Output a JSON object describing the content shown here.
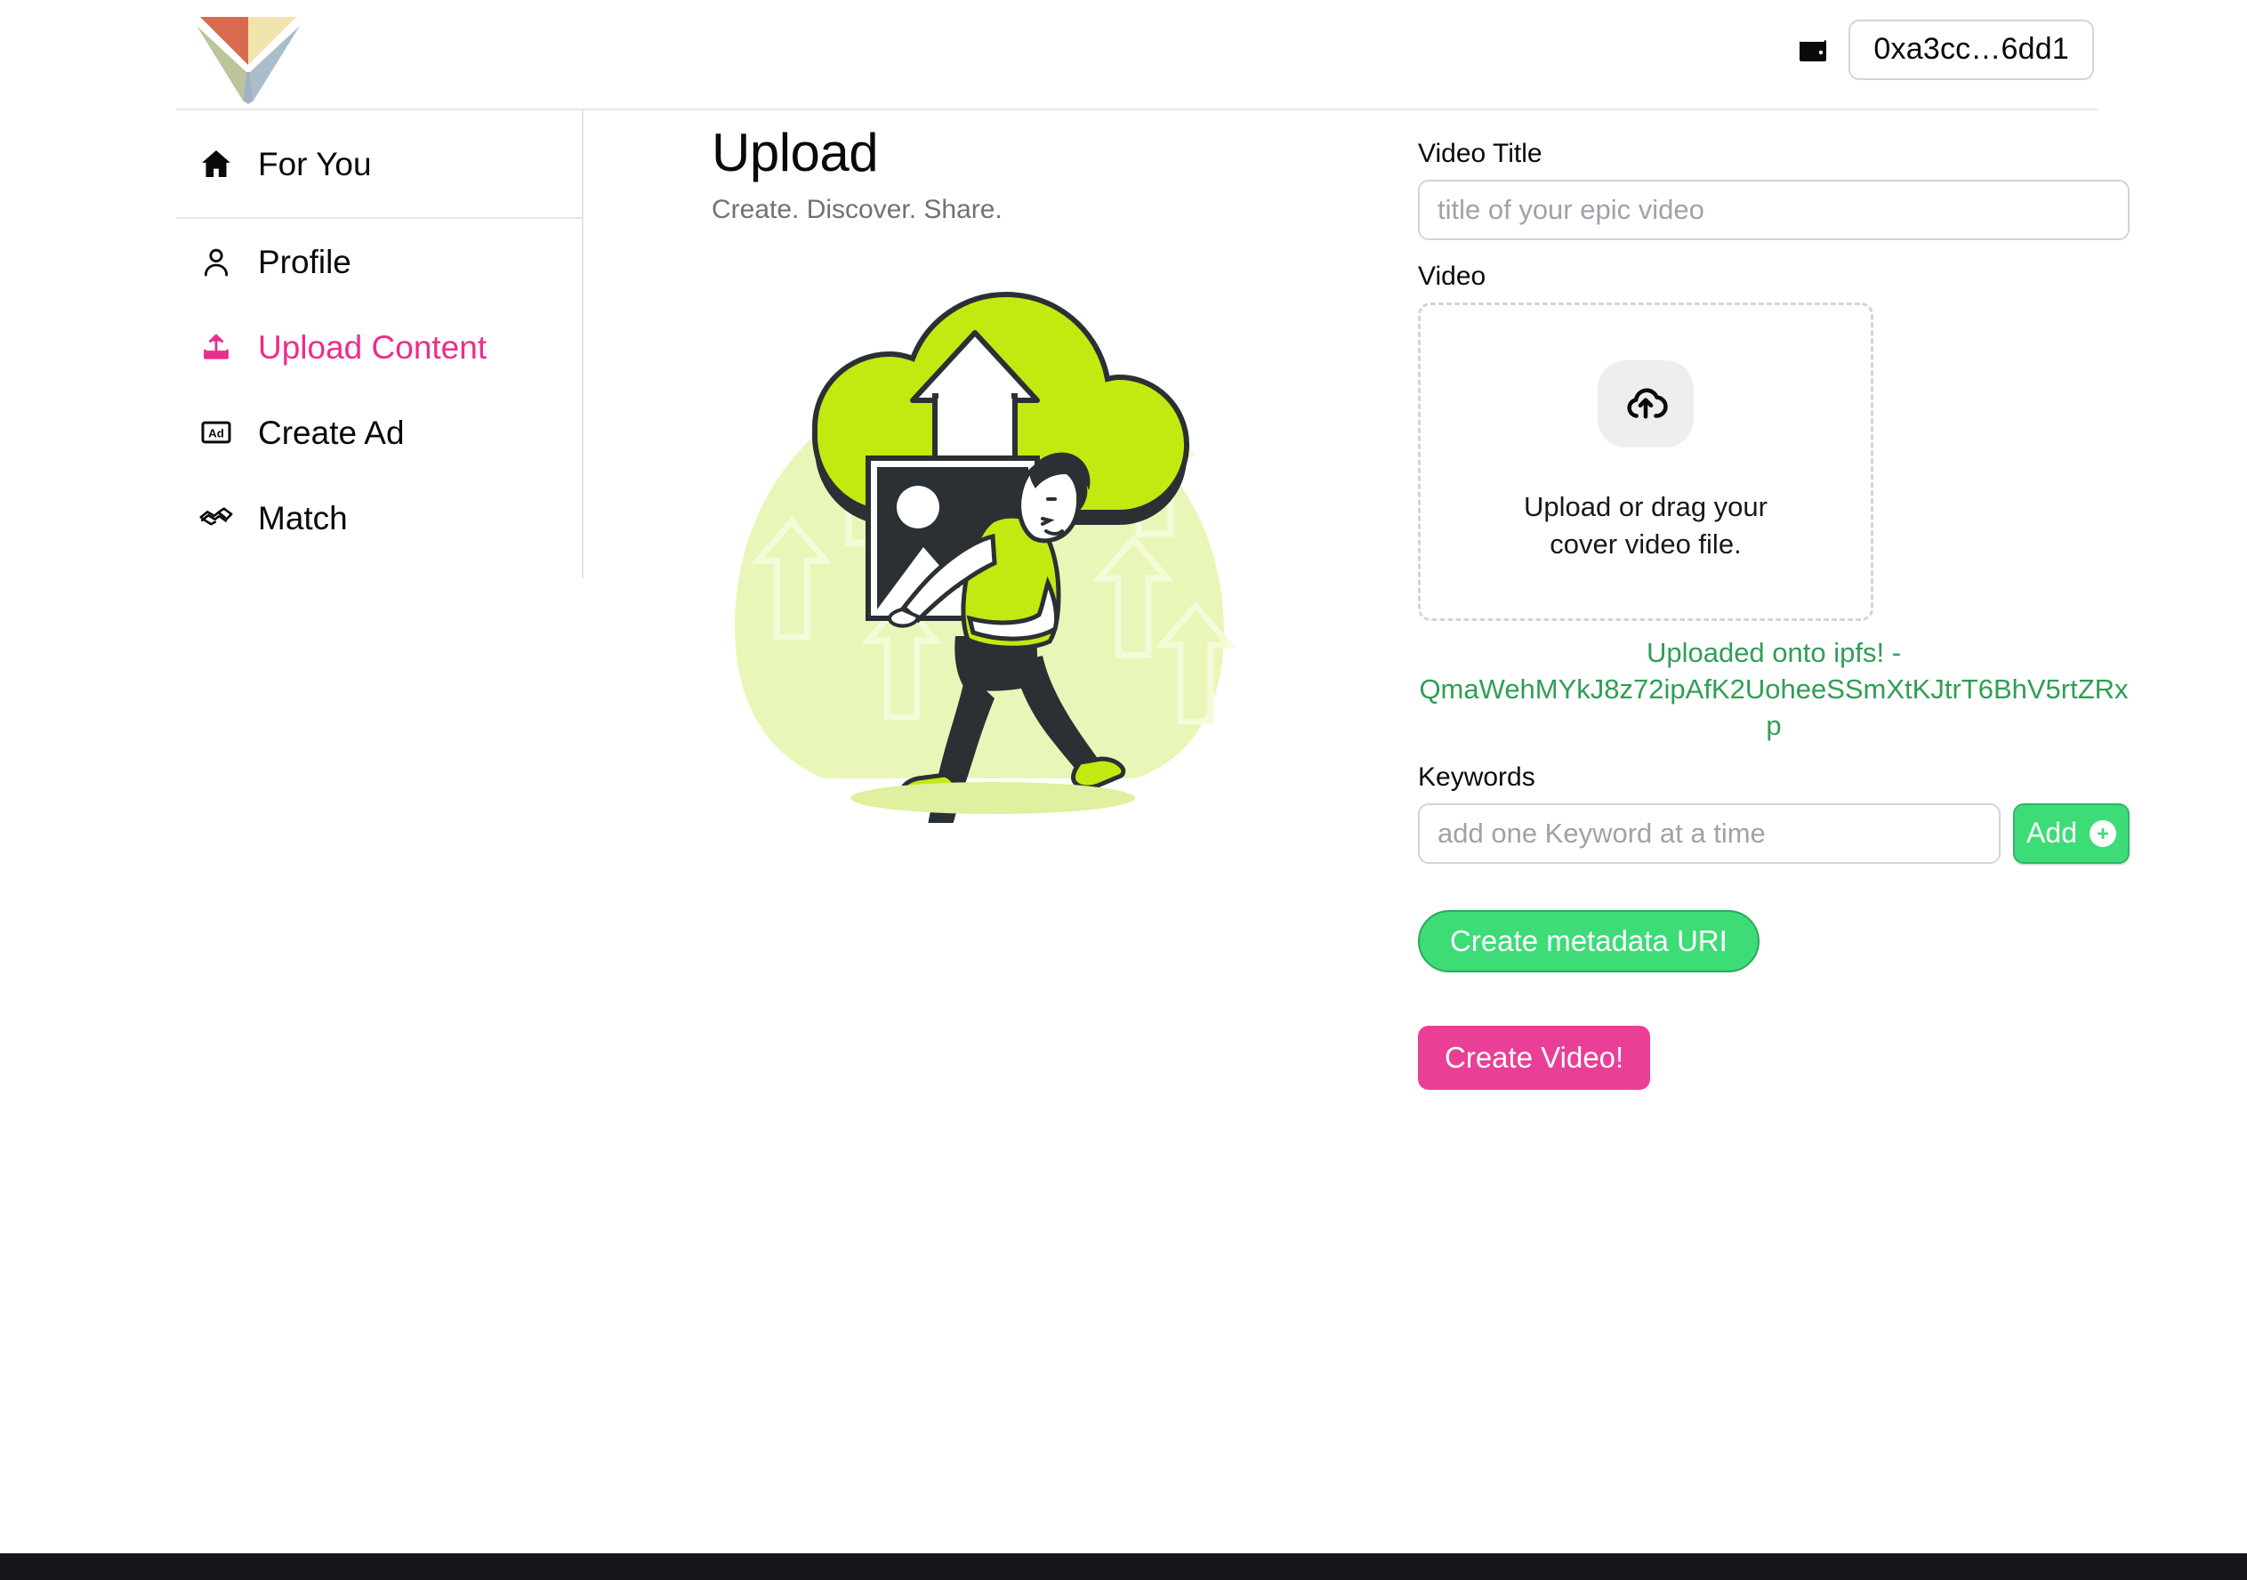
{
  "header": {
    "logo_name": "vfinity-logo",
    "wallet_icon": "wallet-icon",
    "wallet_address": "0xa3cc…6dd1"
  },
  "sidebar": {
    "items": [
      {
        "label": "For You",
        "icon": "home-icon",
        "active": false
      },
      {
        "label": "Profile",
        "icon": "user-icon",
        "active": false
      },
      {
        "label": "Upload Content",
        "icon": "upload-icon",
        "active": true
      },
      {
        "label": "Create Ad",
        "icon": "ad-box-icon",
        "active": false
      },
      {
        "label": "Match",
        "icon": "handshake-icon",
        "active": false
      }
    ]
  },
  "main": {
    "title": "Upload",
    "subtitle": "Create. Discover. Share.",
    "illustration_name": "person-carrying-image-to-cloud-illustration"
  },
  "form": {
    "video_title_label": "Video Title",
    "video_title_placeholder": "title of your epic video",
    "video_title_value": "",
    "video_label": "Video",
    "dropzone_icon": "cloud-upload-icon",
    "dropzone_line1": "Upload or drag your",
    "dropzone_line2": "cover video file.",
    "ipfs_status_line1": "Uploaded onto ipfs! -",
    "ipfs_hash": "QmaWehMYkJ8z72ipAfK2UoheeSSmXtKJtrT6BhV5rtZRxp",
    "keywords_label": "Keywords",
    "keywords_placeholder": "add one Keyword at a time",
    "keywords_value": "",
    "add_button_label": "Add",
    "add_button_icon": "plus-circle-icon",
    "create_metadata_label": "Create metadata URI",
    "create_video_label": "Create Video!"
  },
  "colors": {
    "accent_pink": "#ec2d8a",
    "accent_green": "#3ddc77",
    "ipfs_green": "#2f9e55",
    "illustration_lime": "#c2ea10",
    "illustration_blob": "#e8f7b8",
    "ink": "#2b3034",
    "bottom_bar": "#14161a"
  }
}
